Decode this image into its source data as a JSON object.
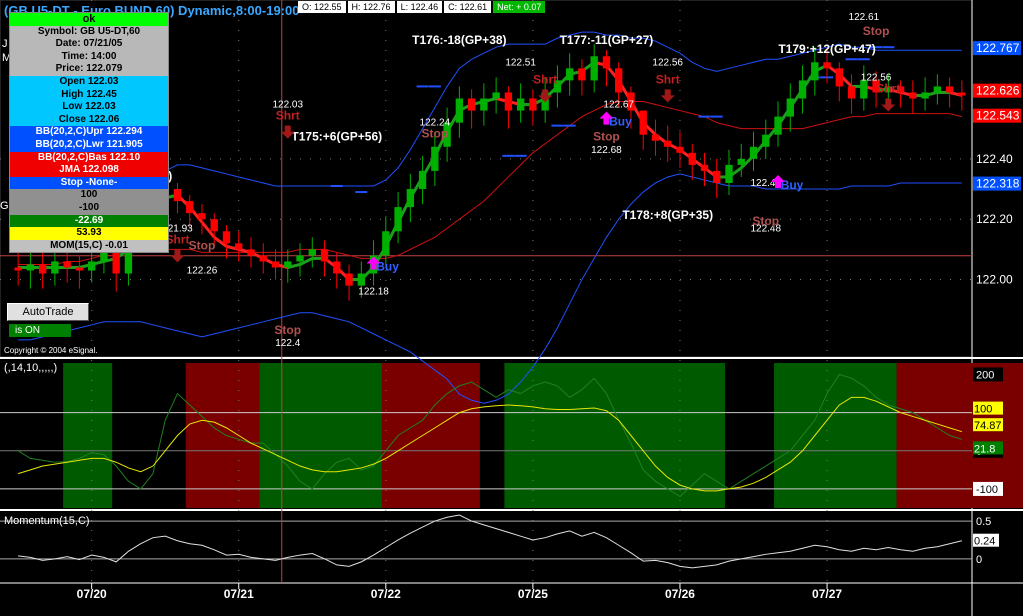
{
  "window": {
    "title": "(GB U5-DT - Euro BUND 60) Dynamic,8:00-19:00"
  },
  "quote_bar": {
    "open": "O: 122.55",
    "high": "H: 122.76",
    "low": "L: 122.46",
    "close": "C: 122.61",
    "net": "Net: + 0.07"
  },
  "info_box": {
    "status": "ok",
    "symbol": "Symbol: GB U5-DT,60",
    "date": "Date: 07/21/05",
    "time": "Time: 14:00",
    "price": "Price: 122.079",
    "open": "Open 122.03",
    "high": "High 122.45",
    "low": "Low 122.03",
    "close": "Close 122.06",
    "bb_upper": "BB(20,2,C)Upr 122.294",
    "bb_lower": "BB(20,2,C)Lwr 121.905",
    "bb_basis": "BB(20,2,C)Bas 122.10",
    "jma": "JMA 122.098",
    "stop": "Stop -None-",
    "val1": "100",
    "val2": "-100",
    "val3": "-22.69",
    "val4": "53.93",
    "mom": "MOM(15,C) -0.01"
  },
  "controls": {
    "autotrade_label": "AutoTrade",
    "status_label": "is ON"
  },
  "copyright": "Copyright © 2004 eSignal.",
  "left_edge_labels": {
    "top1": "J",
    "top2": "M",
    "mid": "G"
  },
  "colors": {
    "candle_up": "#00b000",
    "candle_down": "#ff0000",
    "band": "#2050ff",
    "basis": "#d01010",
    "jma_up": "#1ca01c",
    "jma_down": "#ff2020",
    "buy_arrow": "#ff00ff",
    "stop_text": "#b05050",
    "osc_green_zone": "#005a00",
    "osc_red_zone": "#7a0000"
  },
  "price_axis": {
    "ticks": [
      "122.40",
      "122.20",
      "122.00"
    ],
    "labels": [
      {
        "text": "122.767",
        "bg": "#0050ff",
        "color": "#fff",
        "price": 122.767
      },
      {
        "text": "122.626",
        "bg": "#ff0000",
        "color": "#fff",
        "price": 122.626
      },
      {
        "text": "122.543",
        "bg": "#ff0000",
        "color": "#fff",
        "price": 122.543
      },
      {
        "text": "122.318",
        "bg": "#0050ff",
        "color": "#fff",
        "price": 122.318
      }
    ]
  },
  "annotations": {
    "trades": [
      {
        "text": "T176:-18(GP+38)",
        "time": 36,
        "price": 122.78
      },
      {
        "text": "T177:-11(GP+27)",
        "time": 48,
        "price": 122.78
      },
      {
        "text": "T179:+12(GP+47)",
        "time": 66,
        "price": 122.75
      },
      {
        "text": "T175:+6(GP+56)",
        "time": 26,
        "price": 122.46
      },
      {
        "text": "T178:+8(GP+35)",
        "time": 53,
        "price": 122.2
      },
      {
        "text": "73:-33(+69)",
        "time": 10,
        "price": 122.33
      }
    ],
    "levels": [
      {
        "text": "122.61",
        "time": 69,
        "price": 122.86
      },
      {
        "text": "122.51",
        "time": 41,
        "price": 122.71
      },
      {
        "text": "122.56",
        "time": 53,
        "price": 122.71
      },
      {
        "text": "122.56",
        "time": 70,
        "price": 122.66
      },
      {
        "text": "122.03",
        "time": 22,
        "price": 122.57
      },
      {
        "text": "122.24",
        "time": 34,
        "price": 122.51
      },
      {
        "text": "122.67",
        "time": 49,
        "price": 122.57
      },
      {
        "text": "122.68",
        "time": 48,
        "price": 122.42
      },
      {
        "text": "122.47",
        "time": 61,
        "price": 122.31
      },
      {
        "text": "122.48",
        "time": 61,
        "price": 122.16
      },
      {
        "text": "121.93",
        "time": 13,
        "price": 122.16
      },
      {
        "text": "122.26",
        "time": 15,
        "price": 122.02
      },
      {
        "text": "122.18",
        "time": 29,
        "price": 121.95
      },
      {
        "text": "122.4",
        "time": 22,
        "price": 121.78
      }
    ],
    "shrt": [
      {
        "text": "Shrt",
        "time": 22,
        "price": 122.53
      },
      {
        "text": "Shrt",
        "time": 43,
        "price": 122.65
      },
      {
        "text": "Shrt",
        "time": 53,
        "price": 122.65
      },
      {
        "text": "Shrt",
        "time": 71,
        "price": 122.62
      },
      {
        "text": "Shrt",
        "time": 13,
        "price": 122.12
      }
    ],
    "stop": [
      {
        "text": "Stop",
        "time": 34,
        "price": 122.47
      },
      {
        "text": "Stop",
        "time": 48,
        "price": 122.46
      },
      {
        "text": "Stop",
        "time": 70,
        "price": 122.81
      },
      {
        "text": "Stop",
        "time": 61,
        "price": 122.18
      },
      {
        "text": "Stop",
        "time": 15,
        "price": 122.1
      },
      {
        "text": "Stop",
        "time": 22,
        "price": 121.82
      }
    ],
    "buy": [
      {
        "text": "Buy",
        "time": 48,
        "price": 122.51
      },
      {
        "text": "Buy",
        "time": 29,
        "price": 122.03
      },
      {
        "text": "Buy",
        "time": 62,
        "price": 122.3
      }
    ]
  },
  "oscillator": {
    "label": "(,14,10,,,,,)",
    "ticks": [
      "200",
      "0",
      "-100"
    ],
    "labels": [
      {
        "text": "100",
        "bg": "#ffff00",
        "color": "#000",
        "value": 100
      },
      {
        "text": "74.87",
        "bg": "#ffff00",
        "color": "#000",
        "value": 74.87
      },
      {
        "text": "21.8",
        "bg": "#008000",
        "color": "#fff",
        "value": 21.8
      }
    ]
  },
  "momentum": {
    "label": "Momentum(15,C)",
    "ticks": [
      "0.5",
      "0"
    ],
    "labels": [
      {
        "text": "0.24",
        "bg": "#ffffff",
        "color": "#000",
        "value": 0.24
      }
    ]
  },
  "x_axis": {
    "dates": [
      "07/20",
      "07/21",
      "07/22",
      "07/25",
      "07/26",
      "07/27"
    ]
  },
  "chart_data": {
    "type": "candlestick",
    "time_index": [
      0,
      1,
      2,
      3,
      4,
      5,
      6,
      7,
      8,
      9,
      10,
      11,
      12,
      13,
      14,
      15,
      16,
      17,
      18,
      19,
      20,
      21,
      22,
      23,
      24,
      25,
      26,
      27,
      28,
      29,
      30,
      31,
      32,
      33,
      34,
      35,
      36,
      37,
      38,
      39,
      40,
      41,
      42,
      43,
      44,
      45,
      46,
      47,
      48,
      49,
      50,
      51,
      52,
      53,
      54,
      55,
      56,
      57,
      58,
      59,
      60,
      61,
      62,
      63,
      64,
      65,
      66,
      67,
      68,
      69,
      70,
      71,
      72,
      73,
      74,
      75,
      76,
      77
    ],
    "date_index": {
      "07/20": 6,
      "07/21": 18,
      "07/22": 30,
      "07/25": 42,
      "07/26": 54,
      "07/27": 66
    },
    "open": [
      122.04,
      122.03,
      122.05,
      122.02,
      122.06,
      122.04,
      122.03,
      122.06,
      122.1,
      122.02,
      122.18,
      122.22,
      122.28,
      122.3,
      122.26,
      122.22,
      122.2,
      122.16,
      122.12,
      122.1,
      122.08,
      122.06,
      122.04,
      122.06,
      122.08,
      122.1,
      122.06,
      122.02,
      121.98,
      122.02,
      122.08,
      122.16,
      122.24,
      122.3,
      122.36,
      122.44,
      122.52,
      122.6,
      122.56,
      122.6,
      122.62,
      122.56,
      122.6,
      122.56,
      122.62,
      122.66,
      122.7,
      122.66,
      122.74,
      122.7,
      122.62,
      122.56,
      122.48,
      122.46,
      122.44,
      122.42,
      122.38,
      122.36,
      122.32,
      122.38,
      122.4,
      122.44,
      122.48,
      122.54,
      122.6,
      122.66,
      122.72,
      122.7,
      122.64,
      122.6,
      122.66,
      122.62,
      122.64,
      122.62,
      122.6,
      122.62,
      122.64,
      122.62
    ],
    "close": [
      122.03,
      122.05,
      122.02,
      122.06,
      122.04,
      122.03,
      122.06,
      122.1,
      122.02,
      122.18,
      122.22,
      122.28,
      122.3,
      122.26,
      122.22,
      122.2,
      122.16,
      122.12,
      122.1,
      122.08,
      122.06,
      122.04,
      122.06,
      122.08,
      122.1,
      122.06,
      122.02,
      121.98,
      122.02,
      122.08,
      122.16,
      122.24,
      122.3,
      122.36,
      122.44,
      122.52,
      122.6,
      122.56,
      122.6,
      122.62,
      122.56,
      122.6,
      122.56,
      122.62,
      122.66,
      122.7,
      122.66,
      122.74,
      122.7,
      122.62,
      122.56,
      122.48,
      122.46,
      122.44,
      122.42,
      122.38,
      122.36,
      122.32,
      122.38,
      122.4,
      122.44,
      122.48,
      122.54,
      122.6,
      122.66,
      122.72,
      122.7,
      122.64,
      122.6,
      122.66,
      122.62,
      122.64,
      122.62,
      122.6,
      122.62,
      122.64,
      122.62,
      122.61
    ],
    "high": [
      122.1,
      122.09,
      122.1,
      122.1,
      122.09,
      122.08,
      122.11,
      122.14,
      122.13,
      122.23,
      122.28,
      122.33,
      122.34,
      122.32,
      122.28,
      122.25,
      122.22,
      122.18,
      122.16,
      122.14,
      122.12,
      122.1,
      122.1,
      122.12,
      122.14,
      122.13,
      122.09,
      122.05,
      122.06,
      122.13,
      122.21,
      122.29,
      122.35,
      122.41,
      122.49,
      122.57,
      122.64,
      122.63,
      122.65,
      122.67,
      122.64,
      122.65,
      122.63,
      122.67,
      122.71,
      122.75,
      122.73,
      122.78,
      122.76,
      122.72,
      122.64,
      122.56,
      122.53,
      122.51,
      122.49,
      122.45,
      122.42,
      122.4,
      122.43,
      122.45,
      122.49,
      122.53,
      122.59,
      122.65,
      122.71,
      122.77,
      122.76,
      122.72,
      122.68,
      122.71,
      122.69,
      122.68,
      122.66,
      122.66,
      122.67,
      122.68,
      122.67,
      122.66
    ],
    "low": [
      121.98,
      121.97,
      121.97,
      121.98,
      121.99,
      121.97,
      121.99,
      122.02,
      121.96,
      121.98,
      122.14,
      122.18,
      122.24,
      122.22,
      122.17,
      122.15,
      122.11,
      122.07,
      122.06,
      122.04,
      122.02,
      122.0,
      121.99,
      122.01,
      122.04,
      122.01,
      121.97,
      121.93,
      121.94,
      121.98,
      122.04,
      122.12,
      122.19,
      122.25,
      122.31,
      122.39,
      122.47,
      122.5,
      122.51,
      122.55,
      122.5,
      122.52,
      122.51,
      122.52,
      122.57,
      122.61,
      122.61,
      122.62,
      122.64,
      122.57,
      122.5,
      122.43,
      122.41,
      122.39,
      122.37,
      122.33,
      122.31,
      122.27,
      122.28,
      122.34,
      122.36,
      122.4,
      122.44,
      122.49,
      122.55,
      122.61,
      122.65,
      122.59,
      122.55,
      122.56,
      122.57,
      122.58,
      122.57,
      122.55,
      122.56,
      122.58,
      122.57,
      122.56
    ],
    "bb_upper": [
      122.3,
      122.29,
      122.28,
      122.27,
      122.27,
      122.28,
      122.29,
      122.3,
      122.31,
      122.31,
      122.31,
      122.33,
      122.36,
      122.38,
      122.38,
      122.37,
      122.36,
      122.35,
      122.34,
      122.33,
      122.32,
      122.31,
      122.31,
      122.31,
      122.31,
      122.31,
      122.31,
      122.31,
      122.31,
      122.31,
      122.33,
      122.37,
      122.43,
      122.5,
      122.57,
      122.64,
      122.7,
      122.73,
      122.75,
      122.77,
      122.78,
      122.78,
      122.78,
      122.78,
      122.8,
      122.81,
      122.82,
      122.82,
      122.81,
      122.81,
      122.8,
      122.8,
      122.79,
      122.77,
      122.75,
      122.72,
      122.7,
      122.69,
      122.7,
      122.71,
      122.72,
      122.73,
      122.73,
      122.74,
      122.75,
      122.76,
      122.77,
      122.78,
      122.77,
      122.77,
      122.76,
      122.76,
      122.76,
      122.76,
      122.76,
      122.76,
      122.76,
      122.76
    ],
    "bb_lower": [
      121.8,
      121.8,
      121.81,
      121.82,
      121.83,
      121.84,
      121.85,
      121.86,
      121.86,
      121.86,
      121.86,
      121.85,
      121.84,
      121.83,
      121.82,
      121.81,
      121.82,
      121.83,
      121.84,
      121.85,
      121.86,
      121.87,
      121.88,
      121.89,
      121.89,
      121.88,
      121.87,
      121.86,
      121.84,
      121.82,
      121.8,
      121.78,
      121.76,
      121.73,
      121.7,
      121.67,
      121.62,
      121.6,
      121.59,
      121.6,
      121.62,
      121.66,
      121.71,
      121.77,
      121.84,
      121.92,
      122.0,
      122.07,
      122.14,
      122.2,
      122.25,
      122.29,
      122.32,
      122.34,
      122.35,
      122.34,
      122.33,
      122.32,
      122.31,
      122.31,
      122.31,
      122.3,
      122.3,
      122.3,
      122.3,
      122.3,
      122.3,
      122.3,
      122.31,
      122.31,
      122.31,
      122.31,
      122.32,
      122.32,
      122.32,
      122.32,
      122.32,
      122.32
    ],
    "bb_basis": [
      122.05,
      122.05,
      122.05,
      122.05,
      122.06,
      122.06,
      122.07,
      122.08,
      122.08,
      122.09,
      122.09,
      122.09,
      122.1,
      122.1,
      122.1,
      122.09,
      122.09,
      122.09,
      122.09,
      122.09,
      122.09,
      122.09,
      122.09,
      122.1,
      122.1,
      122.1,
      122.09,
      122.08,
      122.07,
      122.07,
      122.07,
      122.08,
      122.1,
      122.12,
      122.14,
      122.17,
      122.2,
      122.23,
      122.26,
      122.3,
      122.34,
      122.38,
      122.42,
      122.45,
      122.48,
      122.51,
      122.54,
      122.56,
      122.58,
      122.59,
      122.59,
      122.59,
      122.58,
      122.57,
      122.56,
      122.55,
      122.54,
      122.52,
      122.51,
      122.5,
      122.5,
      122.5,
      122.5,
      122.5,
      122.5,
      122.51,
      122.52,
      122.53,
      122.54,
      122.54,
      122.55,
      122.55,
      122.55,
      122.55,
      122.55,
      122.55,
      122.55,
      122.54
    ],
    "jma": [
      122.04,
      122.04,
      122.04,
      122.04,
      122.04,
      122.04,
      122.05,
      122.06,
      122.07,
      122.1,
      122.15,
      122.22,
      122.27,
      122.28,
      122.24,
      122.19,
      122.14,
      122.11,
      122.1,
      122.09,
      122.07,
      122.05,
      122.04,
      122.05,
      122.07,
      122.07,
      122.04,
      122.0,
      122.0,
      122.04,
      122.11,
      122.19,
      122.27,
      122.34,
      122.41,
      122.49,
      122.56,
      122.58,
      122.59,
      122.6,
      122.59,
      122.58,
      122.58,
      122.6,
      122.64,
      122.68,
      122.69,
      122.72,
      122.71,
      122.66,
      122.59,
      122.52,
      122.48,
      122.45,
      122.43,
      122.4,
      122.37,
      122.34,
      122.34,
      122.37,
      122.41,
      122.46,
      122.51,
      122.57,
      122.63,
      122.69,
      122.71,
      122.68,
      122.64,
      122.64,
      122.63,
      122.63,
      122.62,
      122.61,
      122.61,
      122.62,
      122.62,
      122.61
    ],
    "osc_line": [
      0,
      -20,
      -25,
      -30,
      -28,
      -20,
      -5,
      -10,
      -40,
      -80,
      -100,
      -60,
      80,
      150,
      120,
      90,
      60,
      40,
      30,
      20,
      20,
      -10,
      -40,
      -80,
      -100,
      -60,
      -30,
      -20,
      -50,
      -40,
      0,
      40,
      60,
      80,
      120,
      150,
      170,
      180,
      160,
      140,
      160,
      150,
      170,
      180,
      170,
      140,
      160,
      190,
      150,
      80,
      20,
      -50,
      -80,
      -100,
      -120,
      -90,
      -60,
      -80,
      -100,
      -80,
      -60,
      -40,
      -20,
      0,
      40,
      80,
      150,
      200,
      190,
      170,
      140,
      120,
      110,
      100,
      80,
      60,
      40,
      30
    ],
    "osc_smooth": [
      -60,
      -50,
      -40,
      -35,
      -30,
      -25,
      -20,
      -20,
      -30,
      -45,
      -55,
      -40,
      0,
      40,
      70,
      80,
      75,
      60,
      40,
      20,
      5,
      -10,
      -25,
      -40,
      -50,
      -55,
      -55,
      -50,
      -45,
      -35,
      -20,
      0,
      20,
      40,
      60,
      80,
      100,
      110,
      115,
      118,
      120,
      118,
      115,
      110,
      108,
      108,
      110,
      112,
      105,
      80,
      40,
      0,
      -40,
      -70,
      -90,
      -100,
      -105,
      -105,
      -100,
      -95,
      -85,
      -70,
      -50,
      -30,
      0,
      40,
      80,
      120,
      140,
      140,
      130,
      115,
      100,
      90,
      80,
      70,
      60,
      50
    ],
    "momentum": [
      0.04,
      0.02,
      -0.02,
      0.0,
      0.03,
      -0.01,
      0.05,
      0.02,
      -0.04,
      0.1,
      0.2,
      0.28,
      0.3,
      0.24,
      0.2,
      0.18,
      0.12,
      0.05,
      0.06,
      0.02,
      0.0,
      -0.02,
      0.02,
      0.05,
      0.07,
      0.0,
      -0.08,
      -0.1,
      -0.04,
      0.05,
      0.15,
      0.25,
      0.34,
      0.42,
      0.5,
      0.55,
      0.58,
      0.5,
      0.45,
      0.4,
      0.35,
      0.3,
      0.25,
      0.28,
      0.33,
      0.37,
      0.3,
      0.35,
      0.28,
      0.18,
      0.08,
      -0.03,
      -0.02,
      -0.05,
      -0.1,
      -0.12,
      -0.1,
      -0.08,
      -0.03,
      0.0,
      0.03,
      0.06,
      0.08,
      0.1,
      0.14,
      0.18,
      0.16,
      0.12,
      0.1,
      0.14,
      0.12,
      0.15,
      0.12,
      0.1,
      0.14,
      0.16,
      0.2,
      0.24
    ],
    "osc_zones": [
      {
        "from": 2,
        "to": 4,
        "color": "green"
      },
      {
        "from": 7,
        "to": 10,
        "color": "red"
      },
      {
        "from": 10,
        "to": 16,
        "color": "green"
      },
      {
        "from": 15,
        "to": 19,
        "color": "red"
      },
      {
        "from": 20,
        "to": 29,
        "color": "green"
      },
      {
        "from": 31,
        "to": 36,
        "color": "green"
      },
      {
        "from": 36,
        "to": 43,
        "color": "red"
      },
      {
        "from": 45,
        "to": 50,
        "color": "green"
      }
    ],
    "price_range": [
      121.75,
      122.88
    ],
    "osc_range": [
      -150,
      230
    ],
    "momentum_range": [
      -0.28,
      0.62
    ]
  }
}
